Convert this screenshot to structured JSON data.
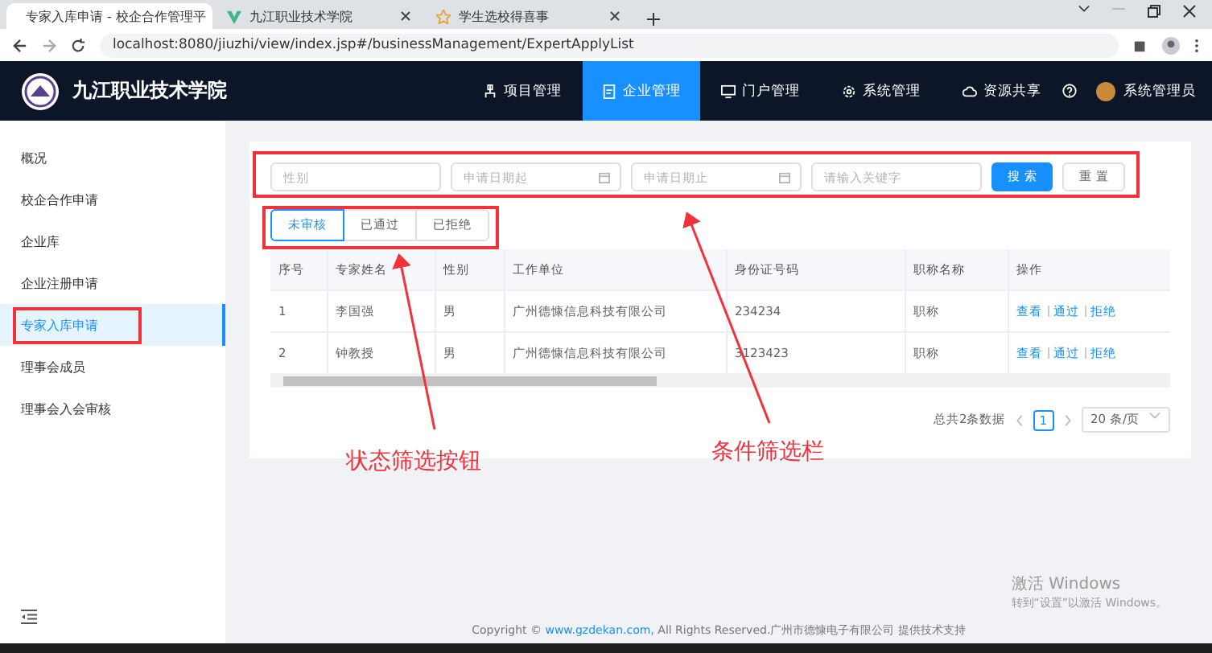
{
  "browser": {
    "tabs": [
      {
        "title": "专家入库申请 - 校企合作管理平",
        "selected": true
      },
      {
        "title": "九江职业技术学院",
        "selected": false
      },
      {
        "title": "学生选校得喜事",
        "selected": false
      }
    ],
    "url": "localhost:8080/jiuzhi/view/index.jsp#/businessManagement/ExpertApplyList"
  },
  "header": {
    "title": "九江职业技术学院",
    "nav": [
      {
        "label": "项目管理",
        "selected": false
      },
      {
        "label": "企业管理",
        "selected": true
      },
      {
        "label": "门户管理",
        "selected": false
      },
      {
        "label": "系统管理",
        "selected": false
      },
      {
        "label": "资源共享",
        "selected": false
      }
    ],
    "user": "系统管理员"
  },
  "sidebar": {
    "items": [
      {
        "label": "概况",
        "selected": false
      },
      {
        "label": "校企合作申请",
        "selected": false
      },
      {
        "label": "企业库",
        "selected": false
      },
      {
        "label": "企业注册申请",
        "selected": false
      },
      {
        "label": "专家入库申请",
        "selected": true
      },
      {
        "label": "理事会成员",
        "selected": false
      },
      {
        "label": "理事会入会审核",
        "selected": false
      }
    ]
  },
  "filters": {
    "fields": [
      {
        "placeholder": "性别",
        "kind": "text"
      },
      {
        "placeholder": "申请日期起",
        "kind": "date"
      },
      {
        "placeholder": "申请日期止",
        "kind": "date"
      },
      {
        "placeholder": "请输入关键字",
        "kind": "text"
      }
    ],
    "buttons": [
      {
        "label": "搜 索",
        "kind": "primary"
      },
      {
        "label": "重 置",
        "kind": "default"
      }
    ]
  },
  "status_tabs": [
    {
      "label": "未审核",
      "selected": true
    },
    {
      "label": "已通过",
      "selected": false
    },
    {
      "label": "已拒绝",
      "selected": false
    }
  ],
  "table": {
    "columns": [
      "序号",
      "专家姓名",
      "性别",
      "工作单位",
      "身份证号码",
      "职称名称",
      "操作"
    ],
    "rows": [
      {
        "cells": [
          "1",
          "李国强",
          "男",
          "广州德慷信息科技有限公司",
          "234234",
          "职称"
        ],
        "actions": [
          "查看",
          "通过",
          "拒绝"
        ]
      },
      {
        "cells": [
          "2",
          "钟教授",
          "男",
          "广州德慷信息科技有限公司",
          "3123423",
          "职称"
        ],
        "actions": [
          "查看",
          "通过",
          "拒绝"
        ]
      }
    ]
  },
  "pagination": {
    "total": "总共2条数据",
    "pages": [
      {
        "label": "1",
        "selected": true
      }
    ],
    "page_size": "20 条/页"
  },
  "annotations": {
    "status_label": "状态筛选按钮",
    "filter_label": "条件筛选栏"
  },
  "footer": {
    "prefix": "Copyright ©",
    "link": "www.gzdekan.com",
    "suffix": ", All Rights Reserved.广州市德慷电子有限公司 提供技术支持"
  },
  "os_notice": {
    "title": "激活 Windows",
    "subtitle": "转到“设置”以激活 Windows。"
  }
}
